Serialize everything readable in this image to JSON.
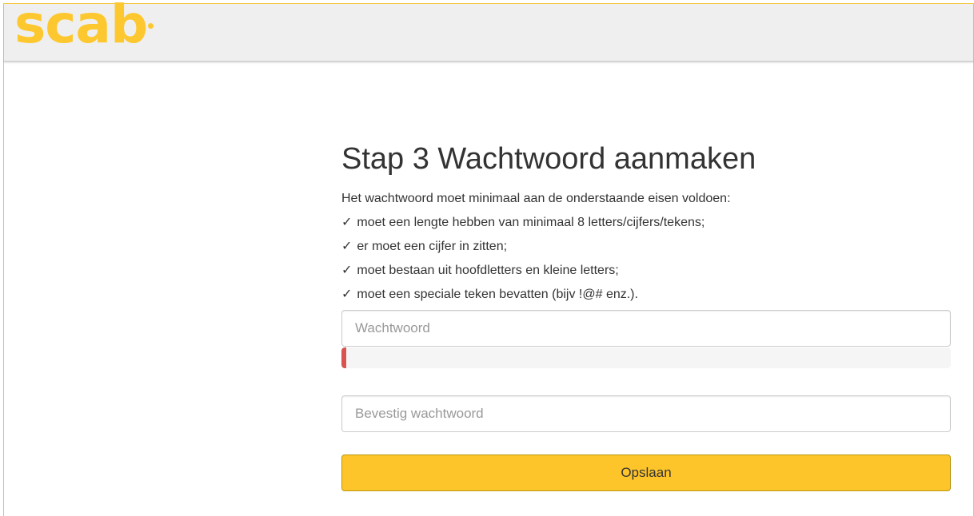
{
  "brand": {
    "logo_text": "scab",
    "color": "#fdc82f"
  },
  "page": {
    "title": "Stap 3 Wachtwoord aanmaken",
    "intro": "Het wachtwoord moet minimaal aan de onderstaande eisen voldoen:",
    "check_icon": "✓",
    "requirements": [
      "moet een lengte hebben van minimaal 8 letters/cijfers/tekens;",
      "er moet een cijfer in zitten;",
      "moet bestaan uit hoofdletters en kleine letters;",
      "moet een speciale teken bevatten (bijv !@# enz.)."
    ]
  },
  "form": {
    "password_placeholder": "Wachtwoord",
    "password_value": "",
    "strength_percent": 0.8,
    "strength_color": "#d9534f",
    "confirm_placeholder": "Bevestig wachtwoord",
    "confirm_value": "",
    "save_label": "Opslaan",
    "save_color": "#fec52b"
  }
}
